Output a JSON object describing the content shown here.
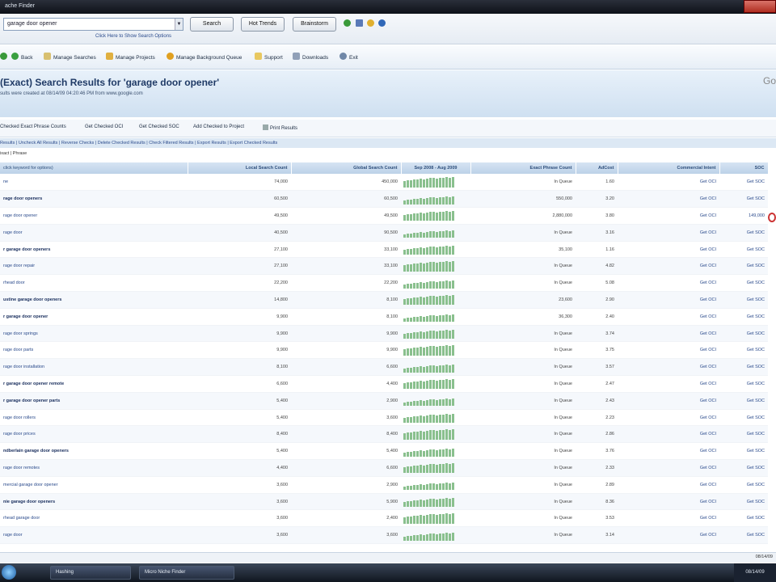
{
  "window": {
    "title": "ache Finder"
  },
  "search": {
    "query": "garage door opener",
    "hint": "Click Here to Show Search Options",
    "buttons": [
      "Search",
      "Hot Trends",
      "Brainstorm"
    ]
  },
  "menu": [
    "Back",
    "Manage Searches",
    "Manage Projects",
    "Manage Background Queue",
    "Support",
    "Downloads",
    "Exit"
  ],
  "page": {
    "title": "(Exact) Search Results for 'garage door opener'",
    "subtitle": "sults were created at 08/14/09 04:20:46 PM from www.google.com",
    "corner": "Go"
  },
  "actions": [
    "Checked Exact Phrase Counts",
    "Get Checked OCI",
    "Get Checked SOC",
    "Add Checked to Project",
    "Print Results"
  ],
  "links_bar": "Results | Uncheck All Results | Reverse Checks | Delete Checked Results | Check Filtered Results | Export Results | Export Checked Results",
  "filter_bar": "ixact | Phrase",
  "table": {
    "columns": [
      "click keyword for options)",
      "Local Search Count",
      "Global Search Count",
      "Sep 2008 - Aug 2009",
      "Exact Phrase Count",
      "AdCost",
      "Commercial Intent",
      "SOC"
    ],
    "rows": [
      {
        "kw": "ne",
        "bold": false,
        "local": "74,000",
        "global": "450,000",
        "exact": "In Queue",
        "adcost": "1.60",
        "ci": "Get OCI",
        "soc": "Get SOC"
      },
      {
        "kw": "rage door openers",
        "bold": true,
        "local": "60,500",
        "global": "60,500",
        "exact": "550,000",
        "adcost": "3.20",
        "ci": "Get OCI",
        "soc": "Get SOC"
      },
      {
        "kw": "rage door opener",
        "bold": false,
        "local": "49,500",
        "global": "49,500",
        "exact": "2,880,000",
        "adcost": "3.80",
        "ci": "Get OCI",
        "soc": "149,000"
      },
      {
        "kw": "rage door",
        "bold": false,
        "local": "40,500",
        "global": "90,500",
        "exact": "In Queue",
        "adcost": "3.16",
        "ci": "Get OCI",
        "soc": "Get SOC"
      },
      {
        "kw": "r garage door openers",
        "bold": true,
        "local": "27,100",
        "global": "33,100",
        "exact": "35,100",
        "adcost": "1.16",
        "ci": "Get OCI",
        "soc": "Get SOC"
      },
      {
        "kw": "rage door repair",
        "bold": false,
        "local": "27,100",
        "global": "33,100",
        "exact": "In Queue",
        "adcost": "4.82",
        "ci": "Get OCI",
        "soc": "Get SOC"
      },
      {
        "kw": "rhead door",
        "bold": false,
        "local": "22,200",
        "global": "22,200",
        "exact": "In Queue",
        "adcost": "5.08",
        "ci": "Get OCI",
        "soc": "Get SOC"
      },
      {
        "kw": "ustine garage door openers",
        "bold": true,
        "local": "14,800",
        "global": "8,100",
        "exact": "23,600",
        "adcost": "2.90",
        "ci": "Get OCI",
        "soc": "Get SOC"
      },
      {
        "kw": "r garage door opener",
        "bold": true,
        "local": "9,900",
        "global": "8,100",
        "exact": "36,300",
        "adcost": "2.40",
        "ci": "Get OCI",
        "soc": "Get SOC"
      },
      {
        "kw": "rage door springs",
        "bold": false,
        "local": "9,900",
        "global": "9,900",
        "exact": "In Queue",
        "adcost": "3.74",
        "ci": "Get OCI",
        "soc": "Get SOC"
      },
      {
        "kw": "rage door parts",
        "bold": false,
        "local": "9,900",
        "global": "9,900",
        "exact": "In Queue",
        "adcost": "3.75",
        "ci": "Get OCI",
        "soc": "Get SOC"
      },
      {
        "kw": "rage door installation",
        "bold": false,
        "local": "8,100",
        "global": "6,600",
        "exact": "In Queue",
        "adcost": "3.57",
        "ci": "Get OCI",
        "soc": "Get SOC"
      },
      {
        "kw": "r garage door opener remote",
        "bold": true,
        "local": "6,600",
        "global": "4,400",
        "exact": "In Queue",
        "adcost": "2.47",
        "ci": "Get OCI",
        "soc": "Get SOC"
      },
      {
        "kw": "r garage door opener parts",
        "bold": true,
        "local": "5,400",
        "global": "2,900",
        "exact": "In Queue",
        "adcost": "2.43",
        "ci": "Get OCI",
        "soc": "Get SOC"
      },
      {
        "kw": "rage door rollers",
        "bold": false,
        "local": "5,400",
        "global": "3,600",
        "exact": "In Queue",
        "adcost": "2.23",
        "ci": "Get OCI",
        "soc": "Get SOC"
      },
      {
        "kw": "rage door prices",
        "bold": false,
        "local": "8,400",
        "global": "8,400",
        "exact": "In Queue",
        "adcost": "2.86",
        "ci": "Get OCI",
        "soc": "Get SOC"
      },
      {
        "kw": "ndberlain garage door openers",
        "bold": true,
        "local": "5,400",
        "global": "5,400",
        "exact": "In Queue",
        "adcost": "3.76",
        "ci": "Get OCI",
        "soc": "Get SOC"
      },
      {
        "kw": "rage door remotes",
        "bold": false,
        "local": "4,400",
        "global": "6,600",
        "exact": "In Queue",
        "adcost": "2.33",
        "ci": "Get OCI",
        "soc": "Get SOC"
      },
      {
        "kw": "mercial garage door opener",
        "bold": false,
        "local": "3,600",
        "global": "2,900",
        "exact": "In Queue",
        "adcost": "2.89",
        "ci": "Get OCI",
        "soc": "Get SOC"
      },
      {
        "kw": "nie garage door openers",
        "bold": true,
        "local": "3,600",
        "global": "5,900",
        "exact": "In Queue",
        "adcost": "8.36",
        "ci": "Get OCI",
        "soc": "Get SOC"
      },
      {
        "kw": "rhead garage door",
        "bold": false,
        "local": "3,600",
        "global": "2,400",
        "exact": "In Queue",
        "adcost": "3.53",
        "ci": "Get OCI",
        "soc": "Get SOC"
      },
      {
        "kw": "rage door",
        "bold": false,
        "local": "3,600",
        "global": "3,600",
        "exact": "In Queue",
        "adcost": "3.14",
        "ci": "Get OCI",
        "soc": "Get SOC"
      }
    ]
  },
  "taskbar": {
    "tasks": [
      "Hashing",
      "Micro Niche Finder"
    ],
    "clock": "08/14/09"
  }
}
